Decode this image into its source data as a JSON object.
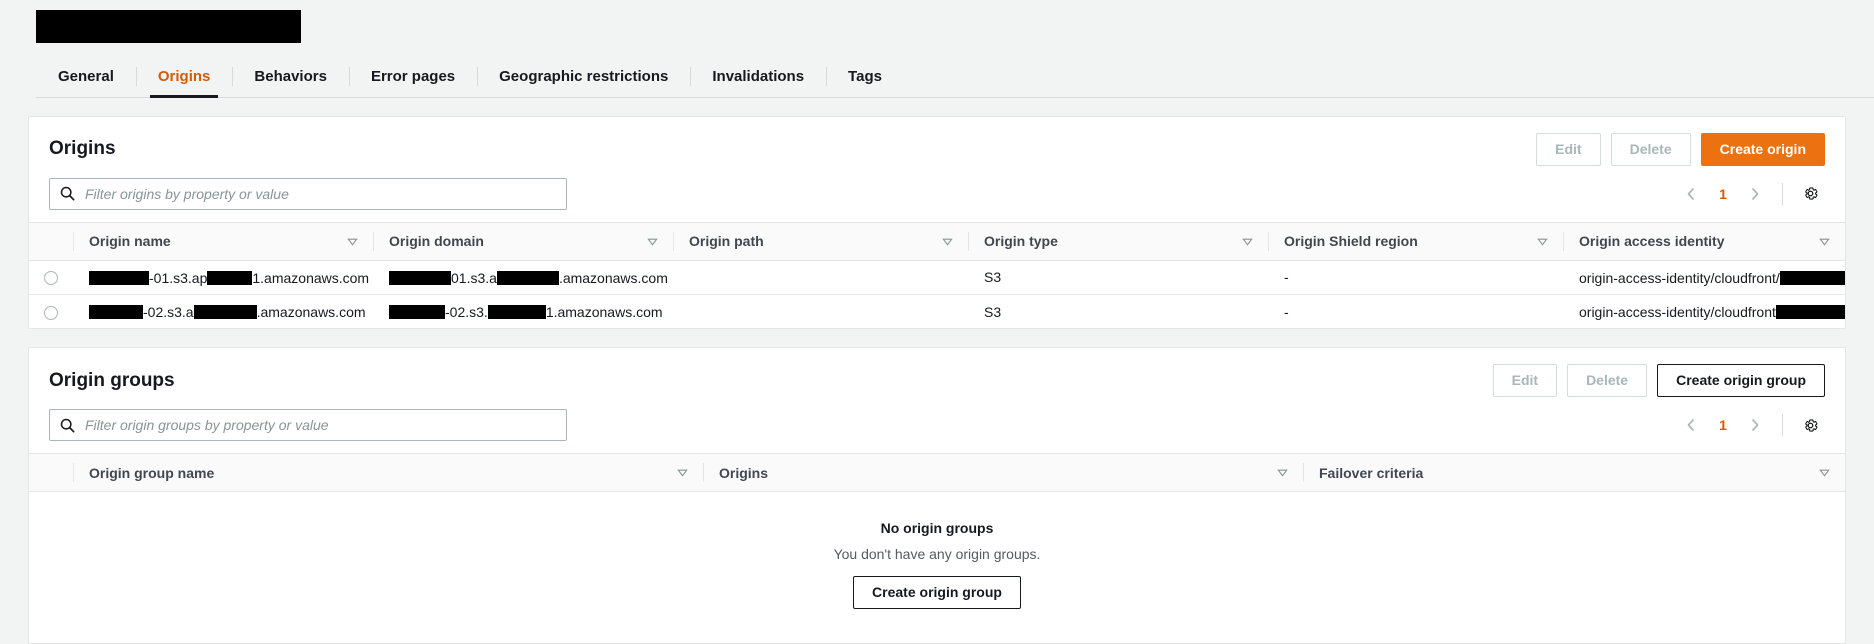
{
  "header": {
    "distribution_name_redacted": true
  },
  "tabs": [
    {
      "label": "General",
      "active": false
    },
    {
      "label": "Origins",
      "active": true
    },
    {
      "label": "Behaviors",
      "active": false
    },
    {
      "label": "Error pages",
      "active": false
    },
    {
      "label": "Geographic restrictions",
      "active": false
    },
    {
      "label": "Invalidations",
      "active": false
    },
    {
      "label": "Tags",
      "active": false
    }
  ],
  "colors": {
    "primary_orange": "#ec7211",
    "active_tab_text": "#d45b07",
    "text_dark": "#16191f",
    "text_muted": "#545b64",
    "disabled_text": "#aab7b8",
    "border": "#e4e6e6",
    "page_bg": "#f2f3f3"
  },
  "origins": {
    "title": "Origins",
    "edit_label": "Edit",
    "delete_label": "Delete",
    "create_label": "Create origin",
    "edit_enabled": false,
    "delete_enabled": false,
    "search": {
      "placeholder": "Filter origins by property or value",
      "value": "",
      "icon": "search-icon"
    },
    "pagination": {
      "prev_icon": "chevron-left-icon",
      "next_icon": "chevron-right-icon",
      "page": "1",
      "settings_icon": "gear-icon"
    },
    "columns": [
      "Origin name",
      "Origin domain",
      "Origin path",
      "Origin type",
      "Origin Shield region",
      "Origin access identity"
    ],
    "rows": [
      {
        "selected": false,
        "origin_name_prefix_redacted": true,
        "origin_name_mid": "-01.s3.ap",
        "origin_name_suffix": "1.amazonaws.com",
        "origin_domain_mid": "01.s3.a",
        "origin_domain_suffix": ".amazonaws.com",
        "origin_path": "",
        "origin_type": "S3",
        "origin_shield_region": "-",
        "origin_access_identity": "origin-access-identity/cloudfront/"
      },
      {
        "selected": false,
        "origin_name_prefix_redacted": true,
        "origin_name_mid": "-02.s3.a",
        "origin_name_suffix": ".amazonaws.com",
        "origin_domain_mid": "-02.s3.",
        "origin_domain_suffix": "1.amazonaws.com",
        "origin_path": "",
        "origin_type": "S3",
        "origin_shield_region": "-",
        "origin_access_identity": "origin-access-identity/cloudfront"
      }
    ]
  },
  "origin_groups": {
    "title": "Origin groups",
    "edit_label": "Edit",
    "delete_label": "Delete",
    "create_label": "Create origin group",
    "edit_enabled": false,
    "delete_enabled": false,
    "search": {
      "placeholder": "Filter origin groups by property or value",
      "value": "",
      "icon": "search-icon"
    },
    "pagination": {
      "prev_icon": "chevron-left-icon",
      "next_icon": "chevron-right-icon",
      "page": "1",
      "settings_icon": "gear-icon"
    },
    "columns": [
      "Origin group name",
      "Origins",
      "Failover criteria"
    ],
    "empty": {
      "title": "No origin groups",
      "subtitle": "You don't have any origin groups.",
      "button_label": "Create origin group"
    }
  }
}
